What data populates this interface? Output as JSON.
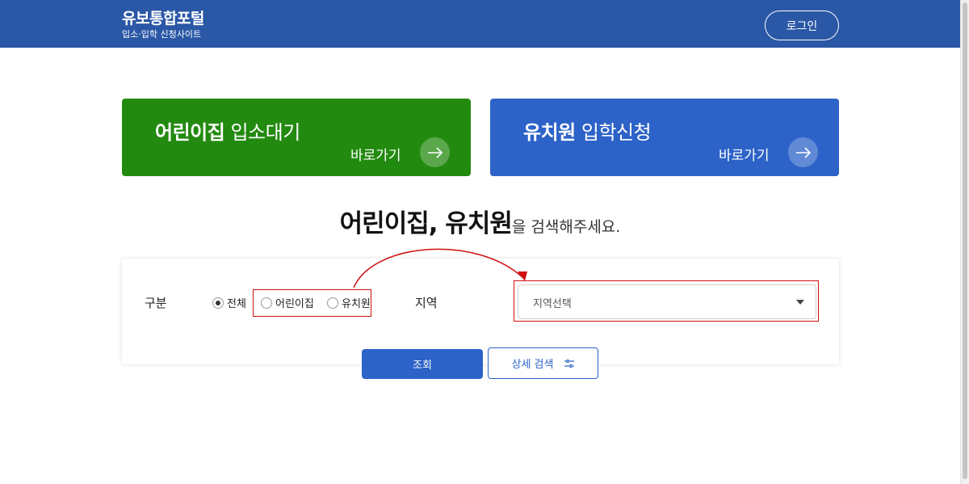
{
  "header": {
    "title": "유보통합포털",
    "subtitle": "입소·입학 신청사이트",
    "login_label": "로그인"
  },
  "cards": [
    {
      "title_bold": "어린이집",
      "title_rest": " 입소대기",
      "link": "바로가기",
      "color": "#238a10",
      "icon": "arrow-right-icon"
    },
    {
      "title_bold": "유치원",
      "title_rest": " 입학신청",
      "link": "바로가기",
      "color": "#2d63c8",
      "icon": "arrow-right-icon"
    }
  ],
  "search": {
    "heading_strong": "어린이집, 유치원",
    "heading_rest": "을 검색해주세요.",
    "type_label": "구분",
    "options": [
      {
        "label": "전체",
        "checked": true
      },
      {
        "label": "어린이집",
        "checked": false
      },
      {
        "label": "유치원",
        "checked": false
      }
    ],
    "region_label": "지역",
    "region_placeholder": "지역선택",
    "search_button": "조회",
    "detail_button": "상세 검색"
  },
  "colors": {
    "header": "#2a57a6",
    "kinder_card": "#238a10",
    "kg_card": "#2d63c8",
    "annotation": "#d01010"
  }
}
